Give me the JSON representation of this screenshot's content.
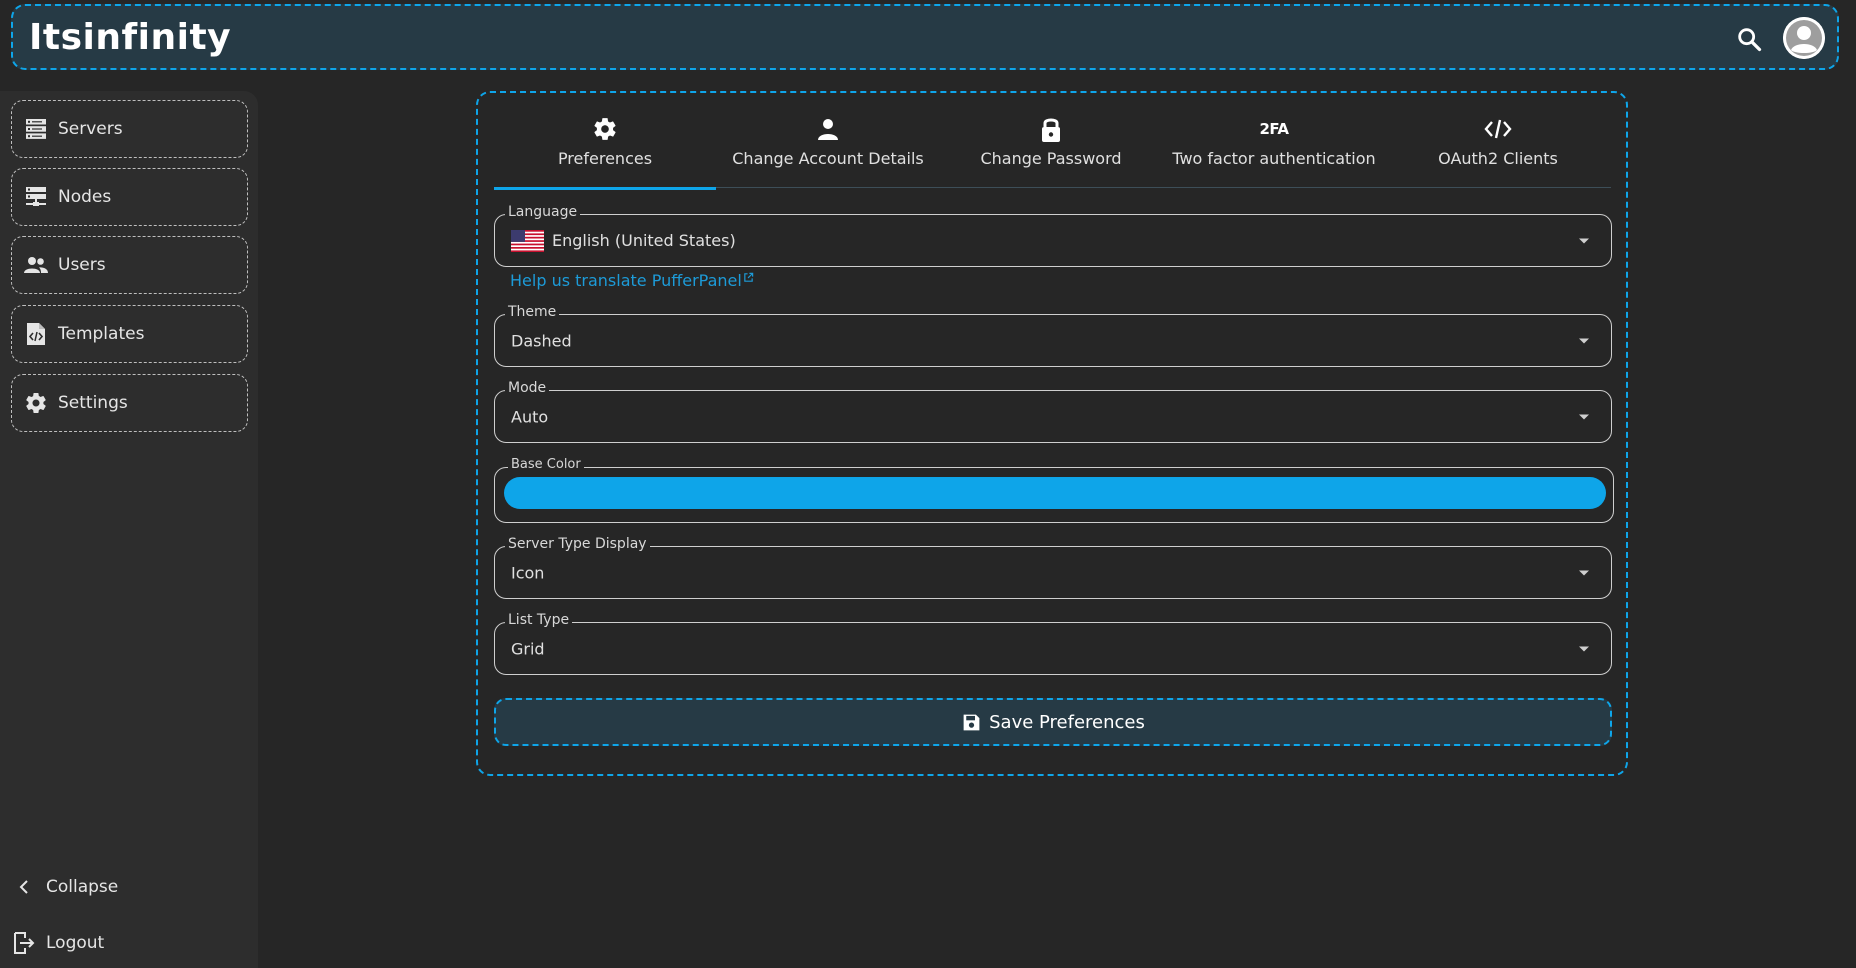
{
  "app": {
    "brand": "Itsinfinity"
  },
  "header": {
    "search_icon": "search-icon",
    "avatar_icon": "user-avatar"
  },
  "sidebar": {
    "items": [
      {
        "label": "Servers",
        "icon": "servers-icon"
      },
      {
        "label": "Nodes",
        "icon": "nodes-icon"
      },
      {
        "label": "Users",
        "icon": "users-icon"
      },
      {
        "label": "Templates",
        "icon": "templates-icon"
      },
      {
        "label": "Settings",
        "icon": "gear-icon"
      }
    ],
    "collapse_label": "Collapse",
    "logout_label": "Logout"
  },
  "tabs": [
    {
      "label": "Preferences",
      "icon": "gear-icon",
      "active": true
    },
    {
      "label": "Change Account Details",
      "icon": "person-icon"
    },
    {
      "label": "Change Password",
      "icon": "lock-icon"
    },
    {
      "label": "Two factor authentication",
      "icon": "2fa-icon",
      "icon_text": "2FA"
    },
    {
      "label": "OAuth2 Clients",
      "icon": "code-icon"
    }
  ],
  "form": {
    "language": {
      "label": "Language",
      "value": "English (United States)"
    },
    "help_link": "Help us translate PufferPanel",
    "theme": {
      "label": "Theme",
      "value": "Dashed"
    },
    "mode": {
      "label": "Mode",
      "value": "Auto"
    },
    "base_color": {
      "label": "Base Color",
      "value": "#0ea5e9"
    },
    "server_type_display": {
      "label": "Server Type Display",
      "value": "Icon"
    },
    "list_type": {
      "label": "List Type",
      "value": "Grid"
    }
  },
  "save_button": {
    "label": "Save Preferences"
  },
  "colors": {
    "accent": "#0ea5e9",
    "background": "#262626",
    "sidebar": "#2d2d2d",
    "header": "#263a45"
  }
}
